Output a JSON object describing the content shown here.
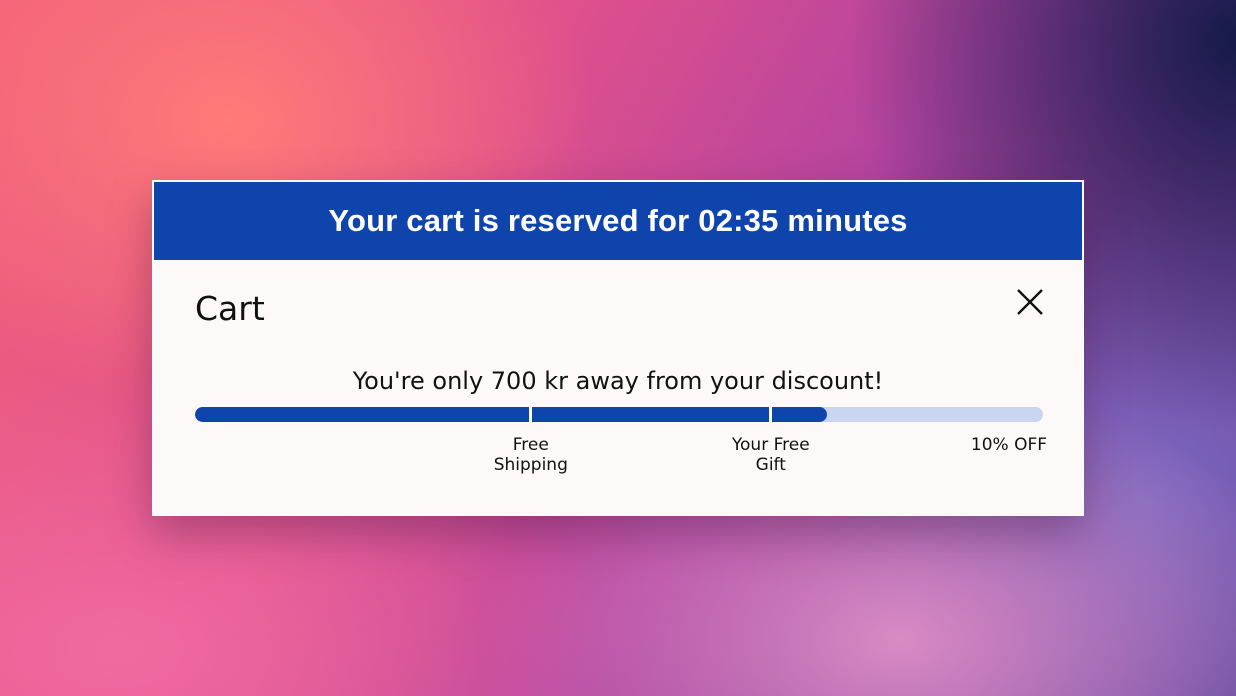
{
  "banner": {
    "text": "Your cart is reserved for 02:35 minutes"
  },
  "cart": {
    "title": "Cart",
    "close_icon": "close-icon",
    "message": "You're only 700 kr away from your discount!",
    "progress": {
      "fraction": 0.745,
      "milestones": [
        {
          "label_line1": "Free",
          "label_line2": "Shipping",
          "fraction": 0.396
        },
        {
          "label_line1": "Your Free",
          "label_line2": "Gift",
          "fraction": 0.679
        },
        {
          "label_line1": "10% OFF",
          "label_line2": "",
          "fraction": 1.0
        }
      ]
    }
  },
  "colors": {
    "accent": "#0f44ac",
    "track": "#c8d6f2",
    "panel": "#fdf9f8"
  }
}
